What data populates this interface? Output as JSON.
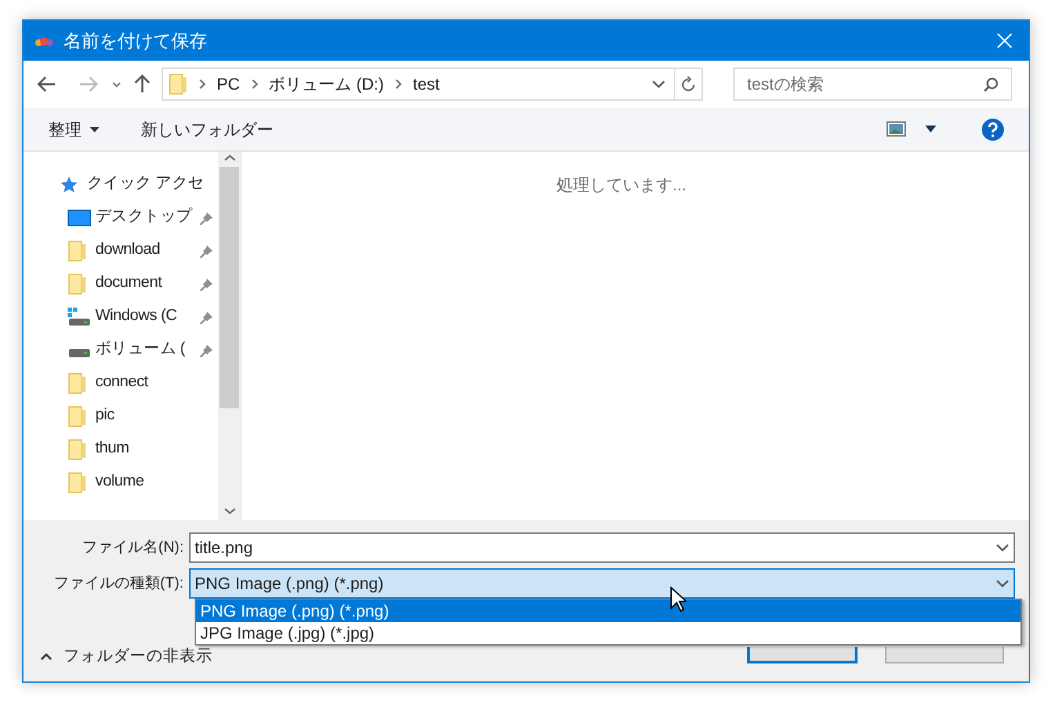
{
  "window": {
    "title": "名前を付けて保存"
  },
  "address": {
    "crumbs": [
      "PC",
      "ボリューム (D:)",
      "test"
    ]
  },
  "search": {
    "placeholder": "testの検索"
  },
  "toolbar": {
    "organize": "整理",
    "new_folder": "新しいフォルダー"
  },
  "sidebar": {
    "items": [
      {
        "kind": "quick",
        "label": "クイック アクセ",
        "pinned": false
      },
      {
        "kind": "desktop",
        "label": "デスクトップ",
        "pinned": true
      },
      {
        "kind": "folder",
        "label": "download",
        "pinned": true
      },
      {
        "kind": "folder",
        "label": "document",
        "pinned": true
      },
      {
        "kind": "windrive",
        "label": "Windows (C",
        "pinned": true
      },
      {
        "kind": "drive",
        "label": "ボリューム (",
        "pinned": true
      },
      {
        "kind": "folder",
        "label": "connect",
        "pinned": false
      },
      {
        "kind": "folder",
        "label": "pic",
        "pinned": false
      },
      {
        "kind": "folder",
        "label": "thum",
        "pinned": false
      },
      {
        "kind": "folder",
        "label": "volume",
        "pinned": false
      }
    ]
  },
  "content": {
    "status": "処理しています..."
  },
  "filename": {
    "label": "ファイル名(N):",
    "value": "title.png"
  },
  "filetype": {
    "label": "ファイルの種類(T):",
    "value": "PNG Image (.png) (*.png)",
    "options": [
      {
        "label": "PNG Image (.png) (*.png)",
        "selected": true
      },
      {
        "label": "JPG Image (.jpg) (*.jpg)",
        "selected": false
      }
    ]
  },
  "hide_folders": "フォルダーの非表示"
}
